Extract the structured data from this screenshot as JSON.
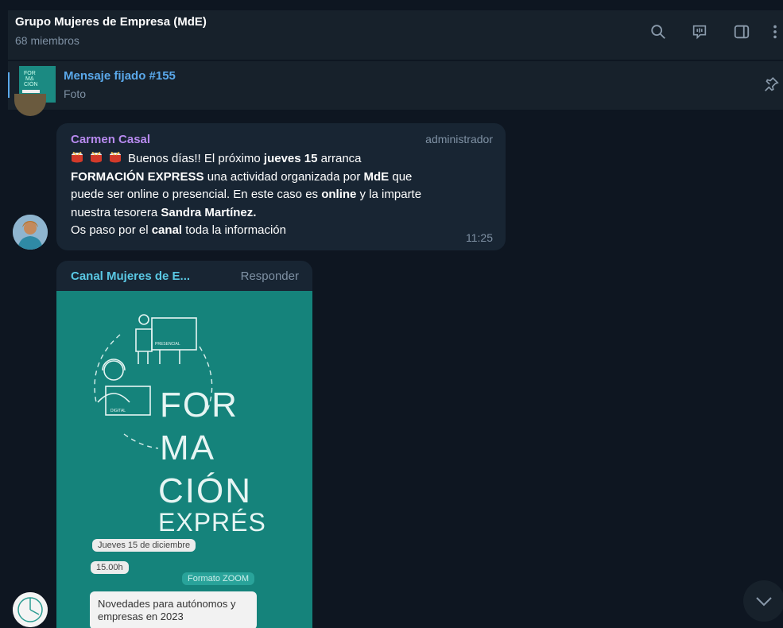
{
  "header": {
    "title": "Grupo Mujeres de Empresa (MdE)",
    "members": "68 miembros"
  },
  "pinned": {
    "title": "Mensaje fijado #155",
    "subtitle": "Foto"
  },
  "messages": [
    {
      "sender": "Carmen Casal",
      "role": "administrador",
      "time": "11:25",
      "lines": [
        {
          "pre": "Buenos días!! El próximo ",
          "b1": "jueves 15",
          "post": " arranca"
        },
        {
          "b1": "FORMACIÓN EXPRESS",
          "post": "  una actividad organizada por ",
          "b2": "MdE",
          "post2": " que"
        },
        {
          "pre": "puede ser online o presencial. En este caso es ",
          "b1": "online",
          "post": " y la imparte"
        },
        {
          "pre": "nuestra tesorera ",
          "b1": "Sandra Martínez."
        },
        {
          "pre": "Os paso por el ",
          "b1": "canal",
          "post": " toda la información"
        }
      ]
    },
    {
      "forwarded_from": "Canal Mujeres de E...",
      "reply_label": "Responder",
      "poster": {
        "presencial_label": "PRESENCIAL",
        "digital_label": "DIGITAL",
        "title_lines": [
          "FOR",
          "MA",
          "CIÓN",
          "EXPRÉS"
        ],
        "date": "Jueves 15 de diciembre",
        "hour": "15.00h",
        "format": "Formato ZOOM",
        "topic": "Novedades para autónomos y empresas en 2023"
      }
    }
  ],
  "colors": {
    "background": "#0e1621",
    "header_bg": "#17212b",
    "bubble_bg": "#182533",
    "sender_color": "#b78aef",
    "link_color": "#5aa8ea",
    "poster_bg": "#15837b"
  },
  "icons": [
    "search-icon",
    "video-chat-icon",
    "sidebar-icon",
    "more-icon",
    "pin-icon",
    "chevron-down-icon",
    "drum-icon"
  ]
}
